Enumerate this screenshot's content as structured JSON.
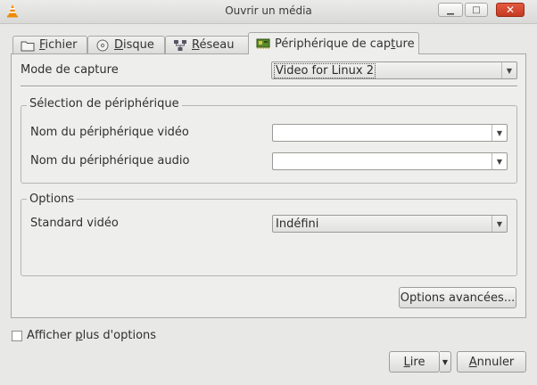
{
  "window": {
    "title": "Ouvrir un média"
  },
  "tabs": [
    {
      "pre": "",
      "u": "F",
      "post": "ichier",
      "icon": "folder-icon"
    },
    {
      "pre": "",
      "u": "D",
      "post": "isque",
      "icon": "disc-icon"
    },
    {
      "pre": "",
      "u": "R",
      "post": "éseau",
      "icon": "network-icon"
    },
    {
      "pre": "Périphérique de cap",
      "u": "t",
      "post": "ure",
      "icon": "capture-card-icon"
    }
  ],
  "capture": {
    "mode_label": "Mode de capture",
    "mode_value": "Video for Linux 2"
  },
  "device_selection": {
    "title": "Sélection de périphérique",
    "video_label": "Nom du périphérique vidéo",
    "video_value": "",
    "audio_label": "Nom du périphérique audio",
    "audio_value": ""
  },
  "options": {
    "title": "Options",
    "standard_label": "Standard vidéo",
    "standard_value": "Indéfini",
    "advanced_button": "Options avancées..."
  },
  "footer": {
    "more_options_pre": "Afficher ",
    "more_options_u": "p",
    "more_options_post": "lus d'options",
    "more_options_checked": false,
    "play_u": "L",
    "play_post": "ire",
    "cancel_u": "A",
    "cancel_post": "nnuler"
  }
}
